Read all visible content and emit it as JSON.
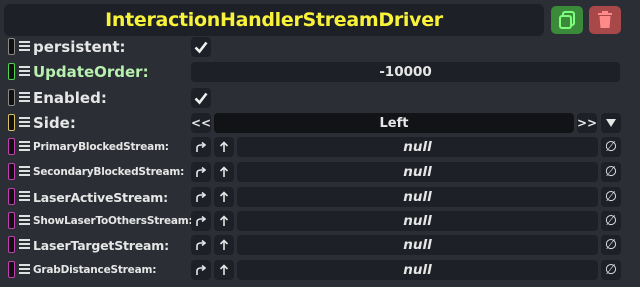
{
  "component": {
    "title": "InteractionHandlerStreamDriver",
    "title_color": "#f8f33a"
  },
  "header": {
    "duplicate_icon": "duplicate-icon",
    "delete_icon": "trash-icon"
  },
  "fields": {
    "persistent": {
      "label": "persistent:",
      "checked": true,
      "connector_color": "#8a8a8a"
    },
    "update_order": {
      "label": "UpdateOrder:",
      "value": "-10000",
      "connector_color": "#4fd24f",
      "label_color": "#b8f0b0"
    },
    "enabled": {
      "label": "Enabled:",
      "checked": true,
      "connector_color": "#8a8a8a"
    },
    "side": {
      "label": "Side:",
      "value": "Left",
      "prev": "<<",
      "next": ">>",
      "dropdown_icon": "triangle-down-icon",
      "connector_color": "#d8c060"
    },
    "streams": [
      {
        "label": "PrimaryBlockedStream:",
        "value": "null"
      },
      {
        "label": "SecondaryBlockedStream:",
        "value": "null"
      },
      {
        "label": "LaserActiveStream:",
        "value": "null"
      },
      {
        "label": "ShowLaserToOthersStream:",
        "value": "null"
      },
      {
        "label": "LaserTargetStream:",
        "value": "null"
      },
      {
        "label": "GrabDistanceStream:",
        "value": "null"
      }
    ],
    "stream_connector_color": "#c040b0",
    "stream_buttons": {
      "jump_icon": "jump-to-icon",
      "up_icon": "arrow-up-icon",
      "clear_label": "∅"
    }
  }
}
